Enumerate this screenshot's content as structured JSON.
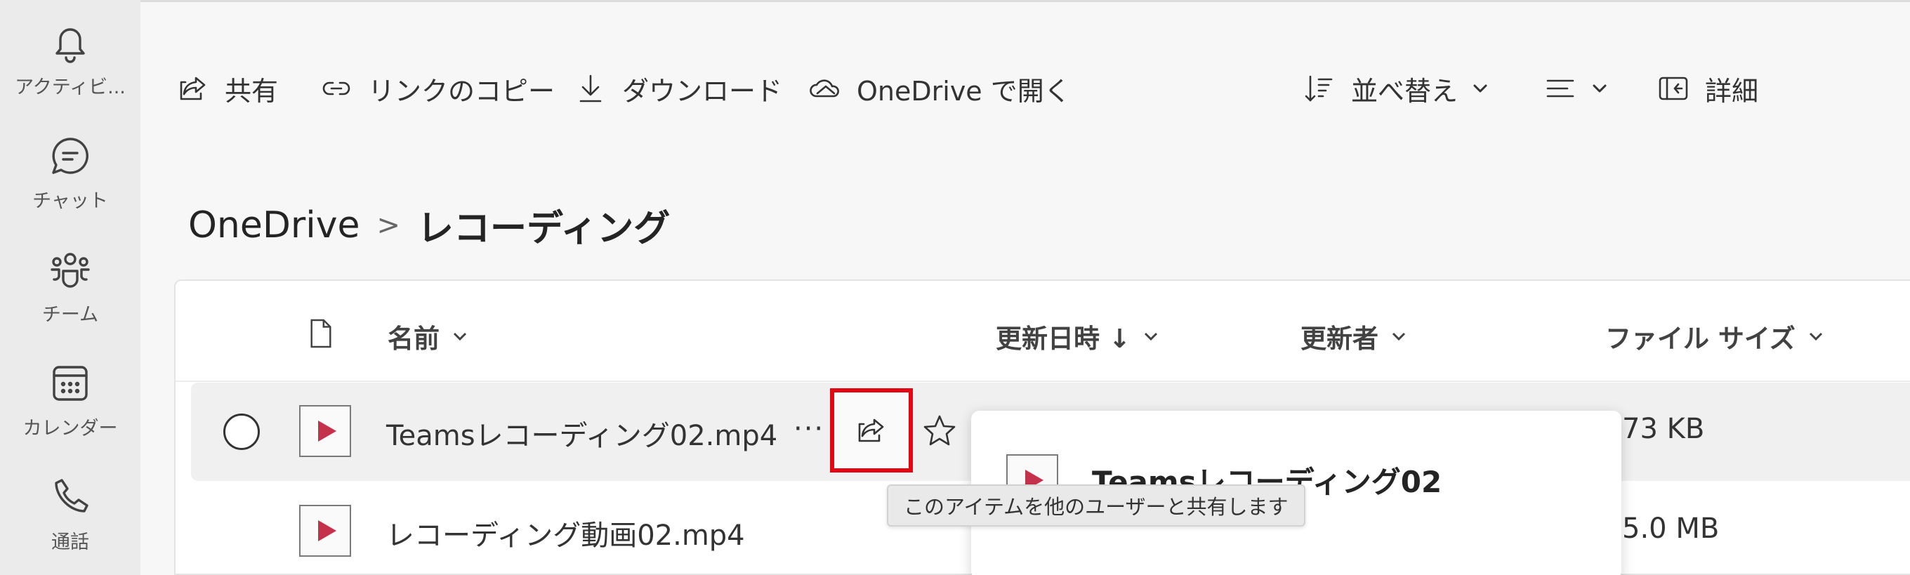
{
  "rail": {
    "items": [
      {
        "icon": "bell-icon",
        "label": "アクティビ..."
      },
      {
        "icon": "chat-icon",
        "label": "チャット"
      },
      {
        "icon": "teams-icon",
        "label": "チーム"
      },
      {
        "icon": "calendar-icon",
        "label": "カレンダー"
      },
      {
        "icon": "phone-icon",
        "label": "通話"
      }
    ]
  },
  "toolbar": {
    "share_label": "共有",
    "copy_link_label": "リンクのコピー",
    "download_label": "ダウンロード",
    "open_onedrive_label": "OneDrive で開く",
    "sort_label": "並べ替え",
    "details_label": "詳細"
  },
  "breadcrumb": {
    "root": "OneDrive",
    "separator": ">",
    "current": "レコーディング"
  },
  "table": {
    "headers": {
      "name": "名前",
      "modified": "更新日時 ↓",
      "modified_by": "更新者",
      "file_size": "ファイル サイズ"
    },
    "rows": [
      {
        "name": "Teamsレコーディング02.mp4",
        "size": "73 KB",
        "selected": true
      },
      {
        "name": "レコーディング動画02.mp4",
        "size": "5.0 MB",
        "selected": false
      }
    ],
    "more_label": "···"
  },
  "hover_card": {
    "title": "Teamsレコーディング02"
  },
  "tooltip": {
    "text": "このアイテムを他のユーザーと共有します"
  },
  "colors": {
    "highlight_border": "#e30613",
    "video_icon": "#c4314b"
  }
}
